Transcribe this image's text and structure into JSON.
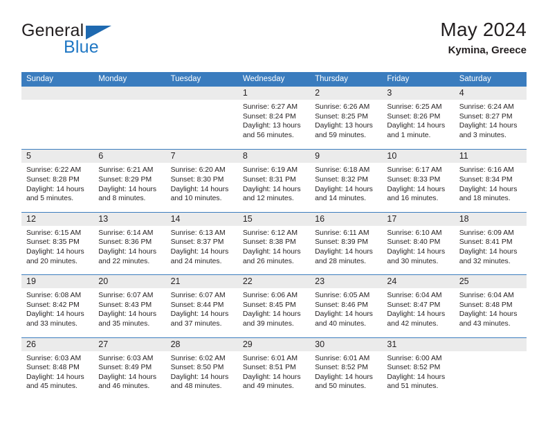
{
  "brand": {
    "name_part1": "General",
    "name_part2": "Blue",
    "flag_icon": "blue-triangle-flag-icon",
    "colors": {
      "black": "#231f20",
      "blue": "#1f77c4",
      "flag": "#1e69b0"
    }
  },
  "header": {
    "title": "May 2024",
    "subtitle": "Kymina, Greece"
  },
  "theme": {
    "header_blue": "#3a7cbe",
    "date_band_gray": "#ebebeb",
    "text": "#231f20"
  },
  "weekdays": [
    "Sunday",
    "Monday",
    "Tuesday",
    "Wednesday",
    "Thursday",
    "Friday",
    "Saturday"
  ],
  "weeks": [
    [
      {
        "day": "",
        "sunrise": "",
        "sunset": "",
        "daylight_line1": "",
        "daylight_line2": "",
        "empty": true
      },
      {
        "day": "",
        "sunrise": "",
        "sunset": "",
        "daylight_line1": "",
        "daylight_line2": "",
        "empty": true
      },
      {
        "day": "",
        "sunrise": "",
        "sunset": "",
        "daylight_line1": "",
        "daylight_line2": "",
        "empty": true
      },
      {
        "day": "1",
        "sunrise": "Sunrise: 6:27 AM",
        "sunset": "Sunset: 8:24 PM",
        "daylight_line1": "Daylight: 13 hours",
        "daylight_line2": "and 56 minutes."
      },
      {
        "day": "2",
        "sunrise": "Sunrise: 6:26 AM",
        "sunset": "Sunset: 8:25 PM",
        "daylight_line1": "Daylight: 13 hours",
        "daylight_line2": "and 59 minutes."
      },
      {
        "day": "3",
        "sunrise": "Sunrise: 6:25 AM",
        "sunset": "Sunset: 8:26 PM",
        "daylight_line1": "Daylight: 14 hours",
        "daylight_line2": "and 1 minute."
      },
      {
        "day": "4",
        "sunrise": "Sunrise: 6:24 AM",
        "sunset": "Sunset: 8:27 PM",
        "daylight_line1": "Daylight: 14 hours",
        "daylight_line2": "and 3 minutes."
      }
    ],
    [
      {
        "day": "5",
        "sunrise": "Sunrise: 6:22 AM",
        "sunset": "Sunset: 8:28 PM",
        "daylight_line1": "Daylight: 14 hours",
        "daylight_line2": "and 5 minutes."
      },
      {
        "day": "6",
        "sunrise": "Sunrise: 6:21 AM",
        "sunset": "Sunset: 8:29 PM",
        "daylight_line1": "Daylight: 14 hours",
        "daylight_line2": "and 8 minutes."
      },
      {
        "day": "7",
        "sunrise": "Sunrise: 6:20 AM",
        "sunset": "Sunset: 8:30 PM",
        "daylight_line1": "Daylight: 14 hours",
        "daylight_line2": "and 10 minutes."
      },
      {
        "day": "8",
        "sunrise": "Sunrise: 6:19 AM",
        "sunset": "Sunset: 8:31 PM",
        "daylight_line1": "Daylight: 14 hours",
        "daylight_line2": "and 12 minutes."
      },
      {
        "day": "9",
        "sunrise": "Sunrise: 6:18 AM",
        "sunset": "Sunset: 8:32 PM",
        "daylight_line1": "Daylight: 14 hours",
        "daylight_line2": "and 14 minutes."
      },
      {
        "day": "10",
        "sunrise": "Sunrise: 6:17 AM",
        "sunset": "Sunset: 8:33 PM",
        "daylight_line1": "Daylight: 14 hours",
        "daylight_line2": "and 16 minutes."
      },
      {
        "day": "11",
        "sunrise": "Sunrise: 6:16 AM",
        "sunset": "Sunset: 8:34 PM",
        "daylight_line1": "Daylight: 14 hours",
        "daylight_line2": "and 18 minutes."
      }
    ],
    [
      {
        "day": "12",
        "sunrise": "Sunrise: 6:15 AM",
        "sunset": "Sunset: 8:35 PM",
        "daylight_line1": "Daylight: 14 hours",
        "daylight_line2": "and 20 minutes."
      },
      {
        "day": "13",
        "sunrise": "Sunrise: 6:14 AM",
        "sunset": "Sunset: 8:36 PM",
        "daylight_line1": "Daylight: 14 hours",
        "daylight_line2": "and 22 minutes."
      },
      {
        "day": "14",
        "sunrise": "Sunrise: 6:13 AM",
        "sunset": "Sunset: 8:37 PM",
        "daylight_line1": "Daylight: 14 hours",
        "daylight_line2": "and 24 minutes."
      },
      {
        "day": "15",
        "sunrise": "Sunrise: 6:12 AM",
        "sunset": "Sunset: 8:38 PM",
        "daylight_line1": "Daylight: 14 hours",
        "daylight_line2": "and 26 minutes."
      },
      {
        "day": "16",
        "sunrise": "Sunrise: 6:11 AM",
        "sunset": "Sunset: 8:39 PM",
        "daylight_line1": "Daylight: 14 hours",
        "daylight_line2": "and 28 minutes."
      },
      {
        "day": "17",
        "sunrise": "Sunrise: 6:10 AM",
        "sunset": "Sunset: 8:40 PM",
        "daylight_line1": "Daylight: 14 hours",
        "daylight_line2": "and 30 minutes."
      },
      {
        "day": "18",
        "sunrise": "Sunrise: 6:09 AM",
        "sunset": "Sunset: 8:41 PM",
        "daylight_line1": "Daylight: 14 hours",
        "daylight_line2": "and 32 minutes."
      }
    ],
    [
      {
        "day": "19",
        "sunrise": "Sunrise: 6:08 AM",
        "sunset": "Sunset: 8:42 PM",
        "daylight_line1": "Daylight: 14 hours",
        "daylight_line2": "and 33 minutes."
      },
      {
        "day": "20",
        "sunrise": "Sunrise: 6:07 AM",
        "sunset": "Sunset: 8:43 PM",
        "daylight_line1": "Daylight: 14 hours",
        "daylight_line2": "and 35 minutes."
      },
      {
        "day": "21",
        "sunrise": "Sunrise: 6:07 AM",
        "sunset": "Sunset: 8:44 PM",
        "daylight_line1": "Daylight: 14 hours",
        "daylight_line2": "and 37 minutes."
      },
      {
        "day": "22",
        "sunrise": "Sunrise: 6:06 AM",
        "sunset": "Sunset: 8:45 PM",
        "daylight_line1": "Daylight: 14 hours",
        "daylight_line2": "and 39 minutes."
      },
      {
        "day": "23",
        "sunrise": "Sunrise: 6:05 AM",
        "sunset": "Sunset: 8:46 PM",
        "daylight_line1": "Daylight: 14 hours",
        "daylight_line2": "and 40 minutes."
      },
      {
        "day": "24",
        "sunrise": "Sunrise: 6:04 AM",
        "sunset": "Sunset: 8:47 PM",
        "daylight_line1": "Daylight: 14 hours",
        "daylight_line2": "and 42 minutes."
      },
      {
        "day": "25",
        "sunrise": "Sunrise: 6:04 AM",
        "sunset": "Sunset: 8:48 PM",
        "daylight_line1": "Daylight: 14 hours",
        "daylight_line2": "and 43 minutes."
      }
    ],
    [
      {
        "day": "26",
        "sunrise": "Sunrise: 6:03 AM",
        "sunset": "Sunset: 8:48 PM",
        "daylight_line1": "Daylight: 14 hours",
        "daylight_line2": "and 45 minutes."
      },
      {
        "day": "27",
        "sunrise": "Sunrise: 6:03 AM",
        "sunset": "Sunset: 8:49 PM",
        "daylight_line1": "Daylight: 14 hours",
        "daylight_line2": "and 46 minutes."
      },
      {
        "day": "28",
        "sunrise": "Sunrise: 6:02 AM",
        "sunset": "Sunset: 8:50 PM",
        "daylight_line1": "Daylight: 14 hours",
        "daylight_line2": "and 48 minutes."
      },
      {
        "day": "29",
        "sunrise": "Sunrise: 6:01 AM",
        "sunset": "Sunset: 8:51 PM",
        "daylight_line1": "Daylight: 14 hours",
        "daylight_line2": "and 49 minutes."
      },
      {
        "day": "30",
        "sunrise": "Sunrise: 6:01 AM",
        "sunset": "Sunset: 8:52 PM",
        "daylight_line1": "Daylight: 14 hours",
        "daylight_line2": "and 50 minutes."
      },
      {
        "day": "31",
        "sunrise": "Sunrise: 6:00 AM",
        "sunset": "Sunset: 8:52 PM",
        "daylight_line1": "Daylight: 14 hours",
        "daylight_line2": "and 51 minutes."
      },
      {
        "day": "",
        "sunrise": "",
        "sunset": "",
        "daylight_line1": "",
        "daylight_line2": "",
        "empty": true
      }
    ]
  ]
}
